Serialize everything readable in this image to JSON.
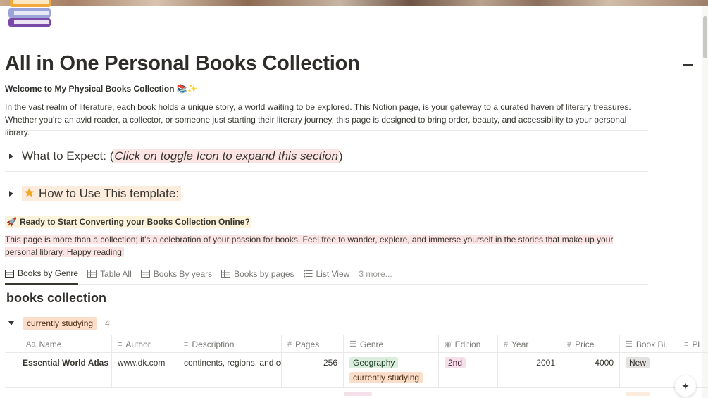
{
  "page": {
    "title": "All in One Personal Books Collection",
    "welcome": "Welcome to My Physical Books Collection 📚✨",
    "intro": "In the vast realm of literature, each book holds a unique story, a world waiting to be explored. This Notion page, is your gateway to a curated haven of literary treasures. Whether you're an avid reader, a collector, or someone just starting their literary journey, this page is designed to bring order, beauty, and accessibility to your personal library."
  },
  "toggles": [
    {
      "prefix": "What to Expect: (",
      "highlight": "Click on toggle Icon to expand this section",
      "suffix": ")"
    },
    {
      "label": "How to Use This template:"
    }
  ],
  "ready": {
    "emoji": "🚀",
    "text": "Ready to Start Converting your Books Collection Online?"
  },
  "passion": "This page is more than a collection; it's a celebration of your passion for books. Feel free to wander, explore, and immerse yourself in the stories that make up your personal library. Happy reading!",
  "tabs": [
    "Books by Genre",
    "Table All",
    "Books By years",
    "Books by pages",
    "List View",
    "3 more..."
  ],
  "database": {
    "title": "books collection",
    "group": {
      "label": "currently studying",
      "count": "4"
    },
    "columns": [
      {
        "icon": "Aa",
        "label": "Name"
      },
      {
        "icon": "≡",
        "label": "Author"
      },
      {
        "icon": "≡",
        "label": "Description"
      },
      {
        "icon": "#",
        "label": "Pages"
      },
      {
        "icon": "☰",
        "label": "Genre"
      },
      {
        "icon": "◉",
        "label": "Edition"
      },
      {
        "icon": "#",
        "label": "Year"
      },
      {
        "icon": "#",
        "label": "Price"
      },
      {
        "icon": "☰",
        "label": "Book Bi..."
      },
      {
        "icon": "≡",
        "label": "Pl"
      }
    ],
    "rows": [
      {
        "name": "Essential World Atlas",
        "author": "www.dk.com",
        "description": "continents, regions, and co",
        "pages": "256",
        "genre": [
          "Geography",
          "currently studying"
        ],
        "edition": "2nd",
        "year": "2001",
        "price": "4000",
        "binding": "New"
      }
    ]
  },
  "colors": {
    "text": "#37352f",
    "muted": "#787774",
    "tag_orange": "#fadec9",
    "tag_green": "#dbeddb",
    "tag_pink": "#f5e0e9",
    "tag_gray": "#e3e2e0",
    "highlight_red": "#fbe4e4",
    "highlight_yellow": "#fbf3db"
  }
}
